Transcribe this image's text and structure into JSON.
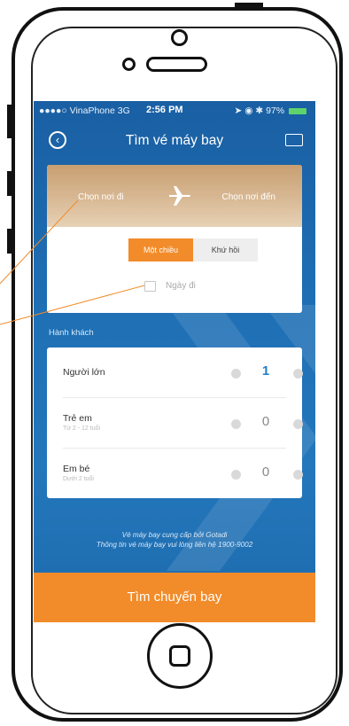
{
  "status_bar": {
    "carrier": "●●●●○ VinaPhone 3G",
    "time": "2:56 PM",
    "battery": "97%"
  },
  "nav": {
    "title": "Tìm vé máy bay",
    "back_icon": "back-circle-icon",
    "ticket_icon": "ticket-icon"
  },
  "route": {
    "from_placeholder": "Chọn nơi đi",
    "to_placeholder": "Chọn nơi đến",
    "plane_icon": "airplane-icon"
  },
  "trip_type": {
    "oneway_label": "Một chiều",
    "roundtrip_label": "Khứ hồi",
    "selected": "oneway"
  },
  "date": {
    "depart_placeholder": "Ngày đi"
  },
  "passengers": {
    "title": "Hành khách",
    "rows": [
      {
        "label": "Người lớn",
        "sub": "",
        "count": "1"
      },
      {
        "label": "Trẻ em",
        "sub": "Từ 2 - 12 tuổi",
        "count": "0"
      },
      {
        "label": "Em bé",
        "sub": "Dưới 2 tuổi",
        "count": "0"
      }
    ]
  },
  "footer": {
    "line1": "Vé máy bay cung cấp bởi Gotadi",
    "line2": "Thông tin vé máy bay vui lòng liên hệ 1900-9002"
  },
  "actions": {
    "search_label": "Tìm chuyến bay"
  },
  "colors": {
    "primary": "#1f6fb5",
    "accent": "#f28c2a",
    "route_bg": "#d6b48e"
  }
}
